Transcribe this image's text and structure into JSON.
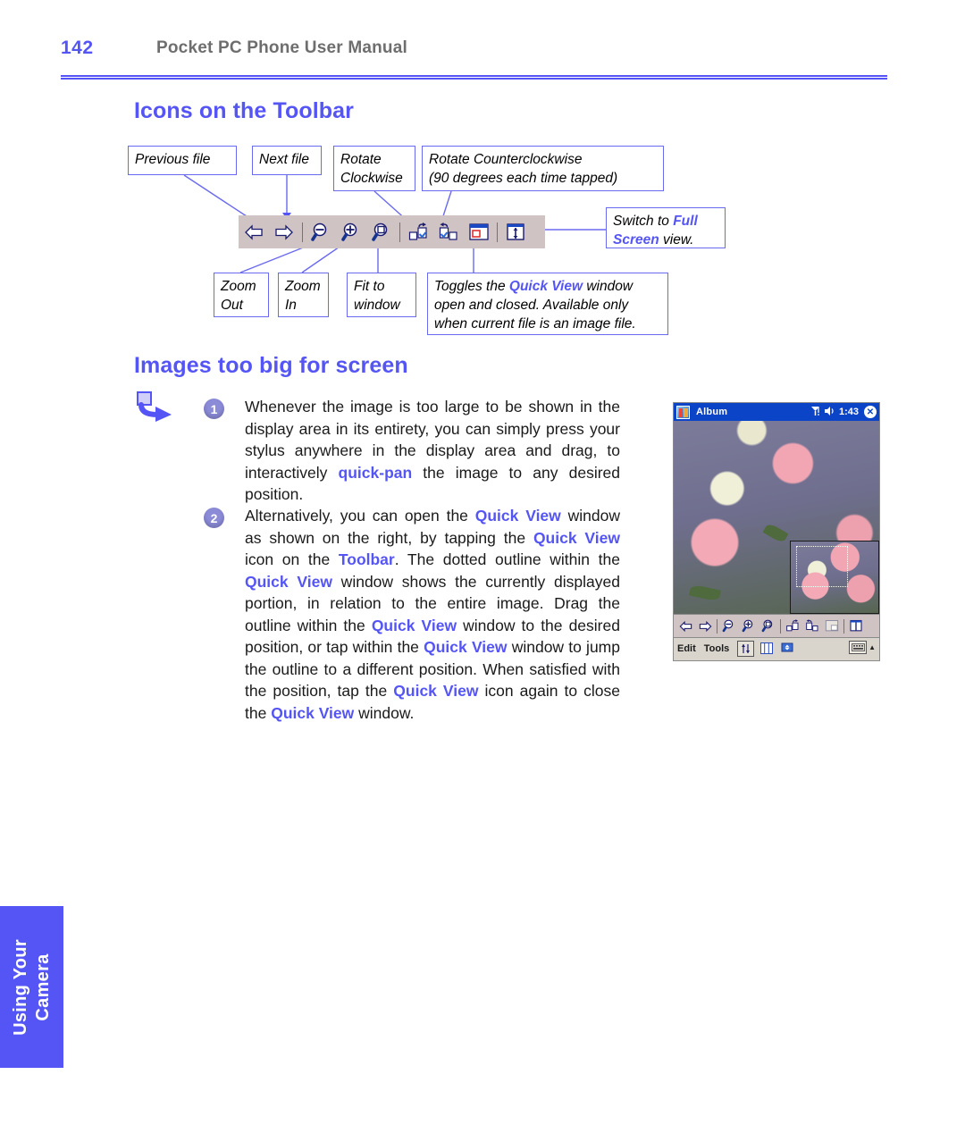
{
  "header": {
    "page_number": "142",
    "manual_title": "Pocket PC Phone User Manual"
  },
  "colors": {
    "accent_blue": "#5555F5",
    "heading_blue": "#5555F5",
    "toolbar_gray": "#CFC3C3",
    "titlebar_blue": "#0B44C6",
    "step_badge": "#8B8BD8"
  },
  "sections": {
    "icons_heading": "Icons on the Toolbar",
    "images_heading": "Images too big for screen"
  },
  "callouts": {
    "previous_file": "Previous file",
    "next_file": "Next file",
    "rotate_clockwise": "Rotate\nClockwise",
    "rotate_counterclockwise": "Rotate Counterclockwise\n(90 degrees each time tapped)",
    "zoom_out": "Zoom\nOut",
    "zoom_in": "Zoom\nIn",
    "fit_to_window": "Fit to\nwindow",
    "full_screen": {
      "prefix": "Switch to ",
      "emphasis": "Full Screen",
      "suffix": " view."
    },
    "quick_view_toggle": {
      "part1": "Toggles the ",
      "emphasis": "Quick View",
      "part2": " window open and closed. Available only when current file is an image file."
    }
  },
  "toolbar_icons": [
    {
      "name": "previous-file-icon",
      "glyph": "arrow-left"
    },
    {
      "name": "next-file-icon",
      "glyph": "arrow-right"
    },
    {
      "name": "zoom-out-icon",
      "glyph": "magnifier-minus"
    },
    {
      "name": "zoom-in-icon",
      "glyph": "magnifier-plus"
    },
    {
      "name": "fit-to-window-icon",
      "glyph": "magnifier-fit"
    },
    {
      "name": "rotate-clockwise-icon",
      "glyph": "rotate-cw"
    },
    {
      "name": "rotate-counterclockwise-icon",
      "glyph": "rotate-ccw"
    },
    {
      "name": "quick-view-icon",
      "glyph": "window-inset"
    },
    {
      "name": "full-screen-icon",
      "glyph": "fullscreen"
    }
  ],
  "steps": [
    {
      "number": "1",
      "segments": [
        {
          "t": "Whenever the image is too large to be shown in the display area in its entirety, you can simply press your stylus anywhere in the display area and drag, to interactively ",
          "bold": false
        },
        {
          "t": "quick-pan",
          "bold": true
        },
        {
          "t": " the image to any desired position.",
          "bold": false
        }
      ]
    },
    {
      "number": "2",
      "segments": [
        {
          "t": "Alternatively, you can open the ",
          "bold": false
        },
        {
          "t": "Quick View",
          "bold": true
        },
        {
          "t": " window as shown on the right, by tapping the ",
          "bold": false
        },
        {
          "t": "Quick View",
          "bold": true
        },
        {
          "t": " icon on the ",
          "bold": false
        },
        {
          "t": "Toolbar",
          "bold": true
        },
        {
          "t": ".  The dotted outline within the ",
          "bold": false
        },
        {
          "t": "Quick View",
          "bold": true
        },
        {
          "t": " window shows the currently displayed portion, in relation to the entire image. Drag the outline within the ",
          "bold": false
        },
        {
          "t": "Quick View",
          "bold": true
        },
        {
          "t": " window to the desired position, or tap within the ",
          "bold": false
        },
        {
          "t": "Quick View",
          "bold": true
        },
        {
          "t": " window to jump the outline to a different position.  When satisfied with the position, tap the ",
          "bold": false
        },
        {
          "t": "Quick View",
          "bold": true
        },
        {
          "t": " icon again to close the ",
          "bold": false
        },
        {
          "t": "Quick View",
          "bold": true
        },
        {
          "t": " window.",
          "bold": false
        }
      ]
    }
  ],
  "pda": {
    "title": "Album",
    "clock": "1:43",
    "status_icons": [
      "signal-icon",
      "speaker-icon"
    ],
    "close_label": "✕",
    "menu_items": [
      "Edit",
      "Tools"
    ],
    "toolbar_icons": [
      "previous-file-icon",
      "next-file-icon",
      "zoom-out-icon",
      "zoom-in-icon",
      "fit-to-window-icon",
      "rotate-clockwise-icon",
      "rotate-counterclockwise-icon",
      "quick-view-icon",
      "full-screen-icon"
    ],
    "menubar_buttons": [
      "sort-icon",
      "thumbnail-icon",
      "slideshow-icon"
    ],
    "input_panel_icon": "keyboard-icon",
    "input_panel_arrow": "▲"
  },
  "side_tab": {
    "line1": "Using Your",
    "line2": "Camera"
  }
}
